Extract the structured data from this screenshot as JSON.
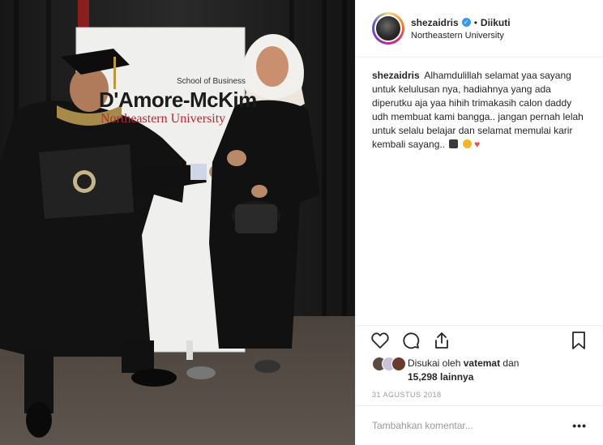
{
  "post": {
    "username": "shezaidris",
    "follow_status": "Diikuti",
    "separator": "•",
    "location": "Northeastern University",
    "caption_username": "shezaidris",
    "caption_text": "Alhamdulillah selamat yaa sayang untuk kelulusan nya, hadiahnya yang ada diperutku aja yaa hihih trimakasih calon daddy udh membuat kami bangga.. jangan pernah lelah untuk selalu belajar dan selamat memulai karir kembali sayang..",
    "likes_prefix": "Disukai oleh",
    "liked_by_user": "vatemat",
    "likes_connector": "dan",
    "likes_count": "15,298",
    "likes_suffix": "lainnya",
    "date": "31 AGUSTUS 2018",
    "comment_placeholder": "Tambahkan komentar...",
    "more_label": "•••"
  },
  "photo": {
    "banner_line1": "School of Business",
    "banner_line2": "D'Amore-McKim",
    "banner_line3": "Northeastern University"
  },
  "colors": {
    "accent": "#3897f0",
    "heart": "#ed4956",
    "text": "#262626",
    "muted": "#999999"
  },
  "icons": [
    "heart-icon",
    "comment-icon",
    "share-icon",
    "bookmark-icon",
    "verified-icon",
    "graduation-emoji",
    "face-emoji",
    "heart-emoji"
  ]
}
